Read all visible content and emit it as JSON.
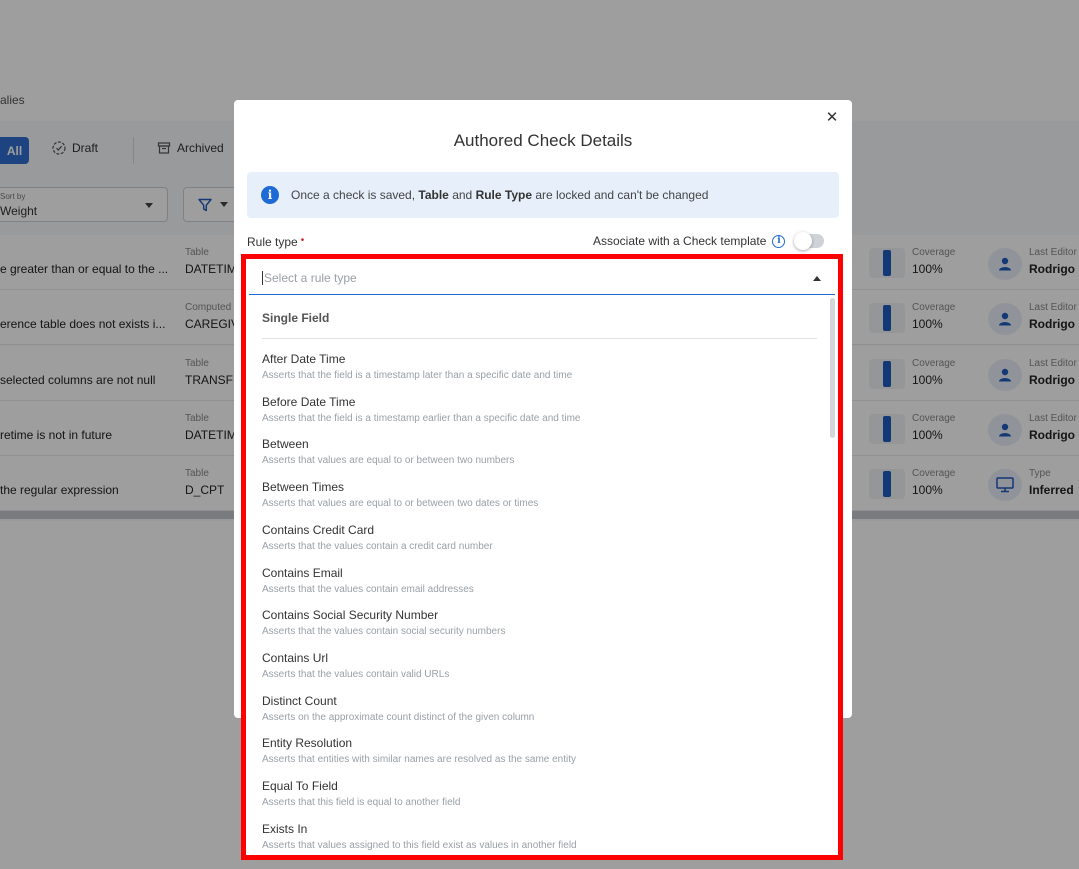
{
  "background": {
    "breadcrumb_tail": "alies",
    "tabs": {
      "all": "All",
      "draft": "Draft",
      "archived": "Archived"
    },
    "sort": {
      "label": "Sort by",
      "value": "Weight"
    },
    "rows": [
      {
        "description": "e greater than or equal to the ...",
        "k1": "Table",
        "v1": "DATETIM",
        "k2": "Coverage",
        "v2": "100%",
        "k3": "Last Editor",
        "v3": "Rodrigo"
      },
      {
        "description": "erence table does not exists i...",
        "k1": "Computed",
        "v1": "CAREGIV",
        "k2": "Coverage",
        "v2": "100%",
        "k3": "Last Editor",
        "v3": "Rodrigo"
      },
      {
        "description": "selected columns are not null",
        "k1": "Table",
        "v1": "TRANSFE",
        "k2": "Coverage",
        "v2": "100%",
        "k3": "Last Editor",
        "v3": "Rodrigo"
      },
      {
        "description": "retime is not in future",
        "k1": "Table",
        "v1": "DATETIM",
        "k2": "Coverage",
        "v2": "100%",
        "k3": "Last Editor",
        "v3": "Rodrigo"
      },
      {
        "description": "the regular expression",
        "k1": "Table",
        "v1": "D_CPT",
        "k2": "Coverage",
        "v2": "100%",
        "k3": "Type",
        "v3": "Inferred"
      }
    ]
  },
  "modal": {
    "title": "Authored Check Details",
    "info": {
      "pre": "Once a check is saved, ",
      "b1": "Table",
      "mid": " and ",
      "b2": "Rule Type",
      "post": " are locked and can't be changed"
    },
    "rule_type_label": "Rule type",
    "required_mark": "•",
    "associate_label": "Associate with a Check template",
    "select_placeholder": "Select a rule type",
    "group_label": "Single Field",
    "options": [
      {
        "title": "After Date Time",
        "desc": "Asserts that the field is a timestamp later than a specific date and time"
      },
      {
        "title": "Before Date Time",
        "desc": "Asserts that the field is a timestamp earlier than a specific date and time"
      },
      {
        "title": "Between",
        "desc": "Asserts that values are equal to or between two numbers"
      },
      {
        "title": "Between Times",
        "desc": "Asserts that values are equal to or between two dates or times"
      },
      {
        "title": "Contains Credit Card",
        "desc": "Asserts that the values contain a credit card number"
      },
      {
        "title": "Contains Email",
        "desc": "Asserts that the values contain email addresses"
      },
      {
        "title": "Contains Social Security Number",
        "desc": "Asserts that the values contain social security numbers"
      },
      {
        "title": "Contains Url",
        "desc": "Asserts that the values contain valid URLs"
      },
      {
        "title": "Distinct Count",
        "desc": "Asserts on the approximate count distinct of the given column"
      },
      {
        "title": "Entity Resolution",
        "desc": "Asserts that entities with similar names are resolved as the same entity"
      },
      {
        "title": "Equal To Field",
        "desc": "Asserts that this field is equal to another field"
      },
      {
        "title": "Exists In",
        "desc": "Asserts that values assigned to this field exist as values in another field"
      }
    ]
  }
}
